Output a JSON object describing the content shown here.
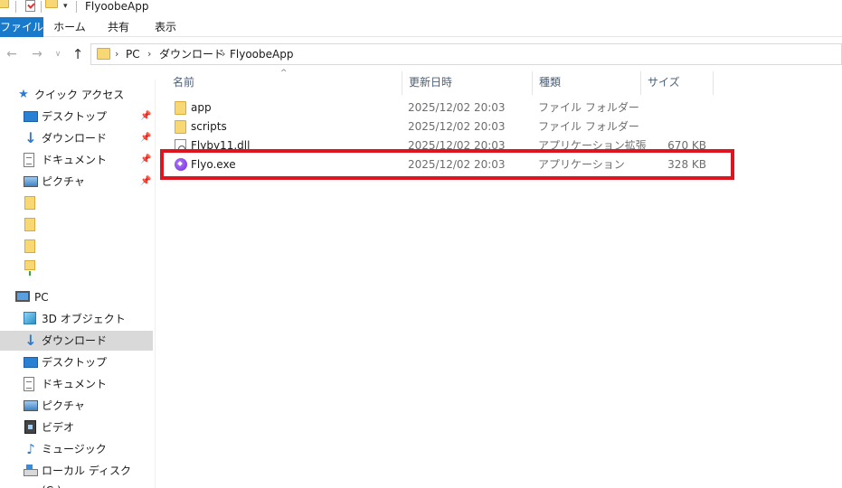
{
  "window": {
    "title": "FlyoobeApp",
    "quick_access_dropdown": "▾"
  },
  "ribbon": {
    "tabs": [
      {
        "label": "ファイル",
        "active": true
      },
      {
        "label": "ホーム"
      },
      {
        "label": "共有"
      },
      {
        "label": "表示"
      }
    ]
  },
  "nav": {
    "back": "←",
    "forward": "→",
    "recent": "∨",
    "up": "↑"
  },
  "address": {
    "crumbs": [
      "PC",
      "ダウンロード",
      "FlyoobeApp"
    ],
    "separator": "›"
  },
  "navpane": {
    "quick_access": {
      "label": "クイック アクセス",
      "items": [
        {
          "label": "デスクトップ",
          "pinned": true
        },
        {
          "label": "ダウンロード",
          "pinned": true
        },
        {
          "label": "ドキュメント",
          "pinned": true
        },
        {
          "label": "ピクチャ",
          "pinned": true
        }
      ],
      "pin_glyph": "📌"
    },
    "pc": {
      "label": "PC",
      "items": [
        {
          "label": "3D オブジェクト"
        },
        {
          "label": "ダウンロード",
          "selected": true
        },
        {
          "label": "デスクトップ"
        },
        {
          "label": "ドキュメント"
        },
        {
          "label": "ピクチャ"
        },
        {
          "label": "ビデオ"
        },
        {
          "label": "ミュージック"
        },
        {
          "label": "ローカル ディスク (C:)"
        }
      ]
    }
  },
  "filelist": {
    "sort_indicator": "^",
    "columns": [
      "名前",
      "更新日時",
      "種類",
      "サイズ"
    ],
    "rows": [
      {
        "icon": "folder-icon",
        "name": "app",
        "date": "2025/12/02 20:03",
        "type": "ファイル フォルダー",
        "size": ""
      },
      {
        "icon": "folder-icon",
        "name": "scripts",
        "date": "2025/12/02 20:03",
        "type": "ファイル フォルダー",
        "size": ""
      },
      {
        "icon": "dll-file-icon",
        "name": "Flyby11.dll",
        "date": "2025/12/02 20:03",
        "type": "アプリケーション拡張",
        "size": "670 KB"
      },
      {
        "icon": "exe-app-icon",
        "name": "Flyo.exe",
        "date": "2025/12/02 20:03",
        "type": "アプリケーション",
        "size": "328 KB"
      }
    ]
  },
  "colors": {
    "file_tab": "#1979ca",
    "highlight": "#e0141e",
    "folder": "#f8d775",
    "selection": "#d9d9d9"
  }
}
